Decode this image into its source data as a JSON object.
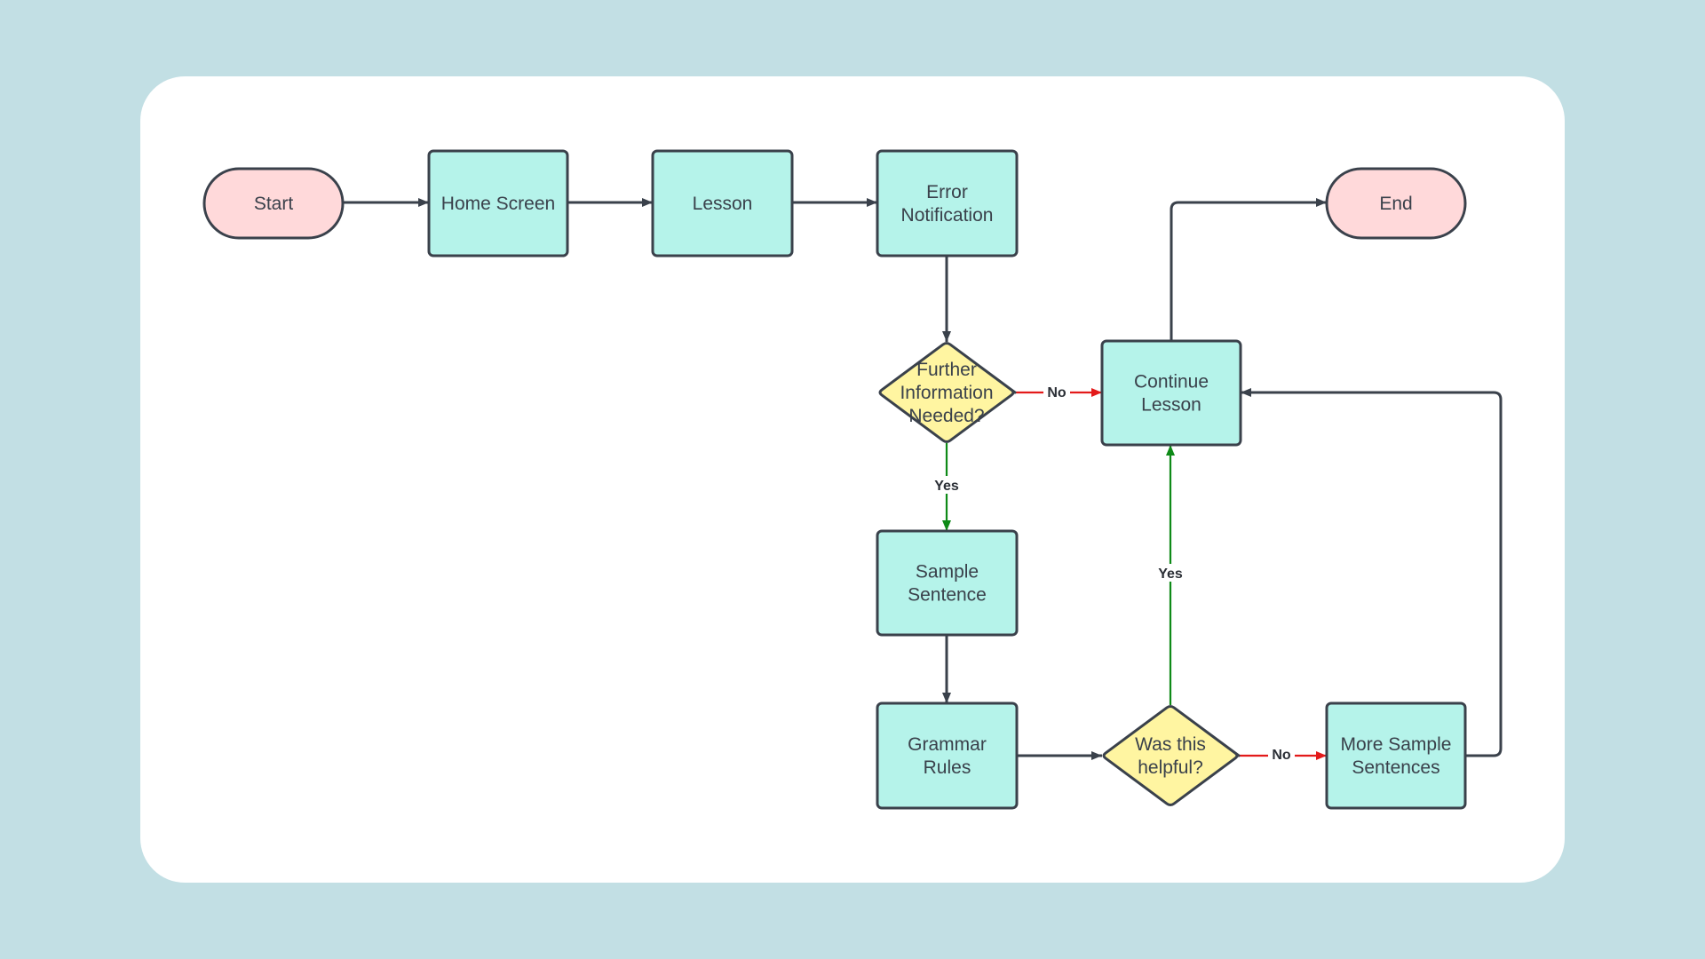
{
  "colors": {
    "background": "#c2dfe4",
    "card": "#ffffff",
    "terminal_fill": "#ffd9da",
    "process_fill": "#b5f3ea",
    "decision_fill": "#fff5a1",
    "stroke": "#3a414b",
    "yes_edge": "#0e8a17",
    "no_edge": "#e31a1a"
  },
  "nodes": [
    {
      "id": "start",
      "type": "terminal",
      "lines": [
        "Start"
      ]
    },
    {
      "id": "home",
      "type": "process",
      "lines": [
        "Home Screen"
      ]
    },
    {
      "id": "lesson",
      "type": "process",
      "lines": [
        "Lesson"
      ]
    },
    {
      "id": "error",
      "type": "process",
      "lines": [
        "Error",
        "Notification"
      ]
    },
    {
      "id": "further",
      "type": "decision",
      "lines": [
        "Further",
        "Information",
        "Needed?"
      ]
    },
    {
      "id": "continue",
      "type": "process",
      "lines": [
        "Continue",
        "Lesson"
      ]
    },
    {
      "id": "end",
      "type": "terminal",
      "lines": [
        "End"
      ]
    },
    {
      "id": "sample",
      "type": "process",
      "lines": [
        "Sample",
        "Sentence"
      ]
    },
    {
      "id": "grammar",
      "type": "process",
      "lines": [
        "Grammar",
        "Rules"
      ]
    },
    {
      "id": "helpful",
      "type": "decision",
      "lines": [
        "Was this",
        "helpful?"
      ]
    },
    {
      "id": "more",
      "type": "process",
      "lines": [
        "More Sample",
        "Sentences"
      ]
    }
  ],
  "edges": [
    {
      "from": "start",
      "to": "home",
      "kind": "default",
      "label": ""
    },
    {
      "from": "home",
      "to": "lesson",
      "kind": "default",
      "label": ""
    },
    {
      "from": "lesson",
      "to": "error",
      "kind": "default",
      "label": ""
    },
    {
      "from": "error",
      "to": "further",
      "kind": "default",
      "label": ""
    },
    {
      "from": "further",
      "to": "continue",
      "kind": "no",
      "label": "No"
    },
    {
      "from": "further",
      "to": "sample",
      "kind": "yes",
      "label": "Yes"
    },
    {
      "from": "continue",
      "to": "end",
      "kind": "default",
      "label": ""
    },
    {
      "from": "sample",
      "to": "grammar",
      "kind": "default",
      "label": ""
    },
    {
      "from": "grammar",
      "to": "helpful",
      "kind": "default",
      "label": ""
    },
    {
      "from": "helpful",
      "to": "continue",
      "kind": "yes",
      "label": "Yes"
    },
    {
      "from": "helpful",
      "to": "more",
      "kind": "no",
      "label": "No"
    },
    {
      "from": "more",
      "to": "continue",
      "kind": "default",
      "label": ""
    }
  ]
}
